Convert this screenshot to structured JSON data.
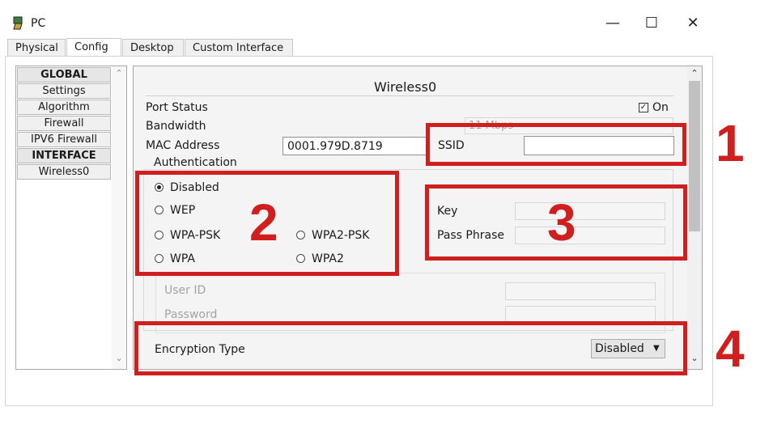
{
  "window": {
    "title": "PC",
    "minimize": "—",
    "maximize": "☐",
    "close": "✕"
  },
  "tabs": [
    "Physical",
    "Config",
    "Desktop",
    "Custom Interface"
  ],
  "nav": {
    "items": [
      "GLOBAL",
      "Settings",
      "Algorithm Settings",
      "Firewall",
      "IPV6 Firewall",
      "INTERFACE",
      "Wireless0"
    ]
  },
  "scroll": {
    "up": "⌃",
    "down": "⌄"
  },
  "panel": {
    "title": "Wireless0",
    "port_status_label": "Port Status",
    "port_status_on": "On",
    "port_status_checked": true,
    "bandwidth_label": "Bandwidth",
    "bandwidth_value": "11 Mbps",
    "mac_label": "MAC Address",
    "mac_value": "0001.979D.8719",
    "ssid_label": "SSID",
    "ssid_value": "",
    "auth_label": "Authentication",
    "auth_options": [
      "Disabled",
      "WEP",
      "WPA-PSK",
      "WPA2-PSK",
      "WPA",
      "WPA2"
    ],
    "auth_selected": "Disabled",
    "key_label": "Key",
    "pass_label": "Pass Phrase",
    "userid_label": "User ID",
    "password_label": "Password",
    "enc_label": "Encryption Type",
    "enc_value": "Disabled"
  },
  "annotations": [
    "1",
    "2",
    "3",
    "4"
  ],
  "colors": {
    "annotation": "#d01f1f"
  }
}
